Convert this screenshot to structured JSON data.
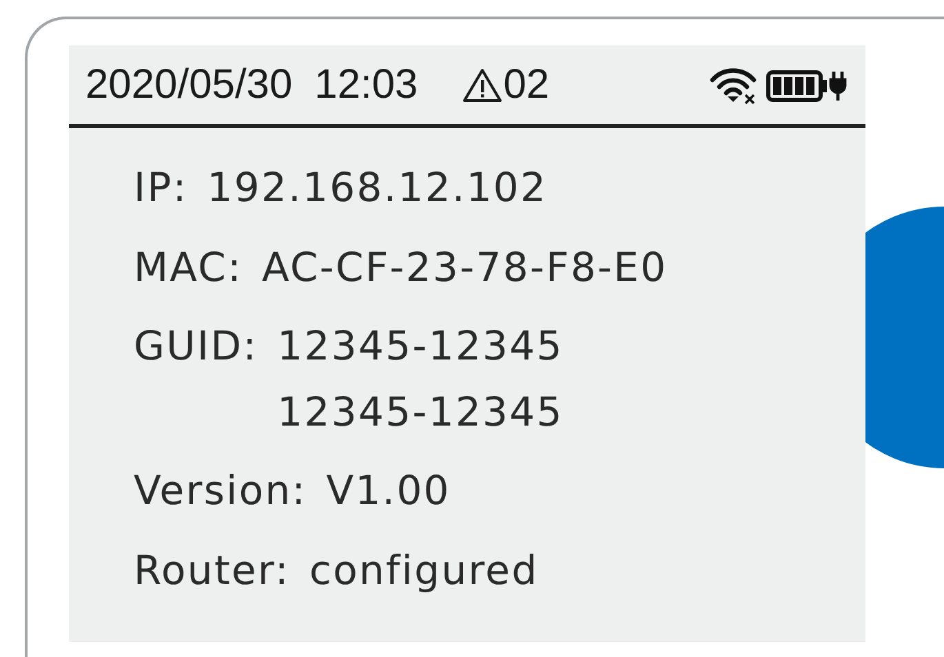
{
  "status_bar": {
    "date": "2020/05/30",
    "time": "12:03",
    "alert_count": "02",
    "wifi_connected": false,
    "charging": true
  },
  "info": [
    {
      "label": "IP:",
      "values": [
        "192.168.12.102"
      ]
    },
    {
      "label": "MAC:",
      "values": [
        "AC-CF-23-78-F8-E0"
      ]
    },
    {
      "label": "GUID:",
      "values": [
        "12345-12345",
        "12345-12345"
      ]
    },
    {
      "label": "Version:",
      "values": [
        "V1.00"
      ]
    },
    {
      "label": "Router:",
      "values": [
        "configured"
      ]
    }
  ]
}
